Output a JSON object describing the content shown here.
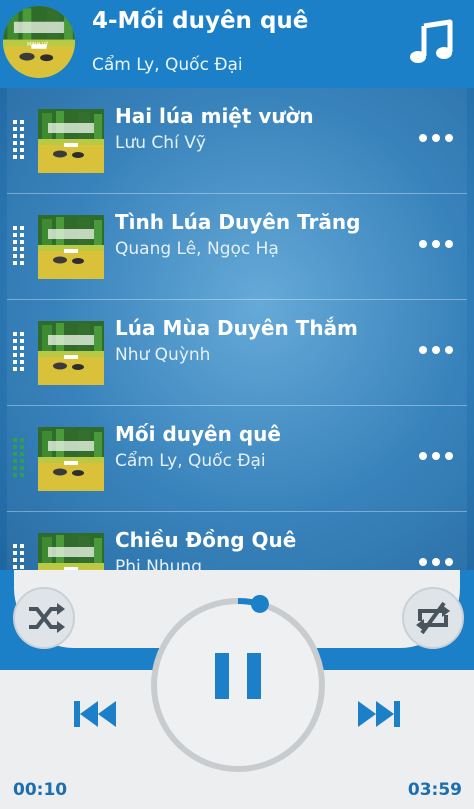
{
  "now_playing": {
    "title": "4-Mối duyên quê",
    "artist": "Cẩm Ly, Quốc Đại",
    "music_icon": "music-note-icon"
  },
  "playlist": [
    {
      "title": "Hai lúa miệt vườn",
      "artist": "Lưu Chí Vỹ",
      "active": false
    },
    {
      "title": "Tình Lúa Duyên Trăng",
      "artist": "Quang Lê, Ngọc Hạ",
      "active": false
    },
    {
      "title": "Lúa Mùa Duyên Thắm",
      "artist": "Như Quỳnh",
      "active": false
    },
    {
      "title": "Mối duyên quê",
      "artist": "Cẩm Ly, Quốc Đại",
      "active": true
    },
    {
      "title": "Chiều Đồng Quê",
      "artist": "Phi Nhung",
      "active": false
    }
  ],
  "cover_art_text": "MINH VỸ",
  "player": {
    "elapsed": "00:10",
    "duration": "03:59",
    "progress": 0.042,
    "state": "playing",
    "controls": [
      "shuffle-icon",
      "repeat-off-icon",
      "previous-icon",
      "pause-icon",
      "next-icon"
    ]
  },
  "colors": {
    "accent": "#1c80c8",
    "active_handle": "#2e9e55",
    "player_bg": "#eceeef"
  }
}
